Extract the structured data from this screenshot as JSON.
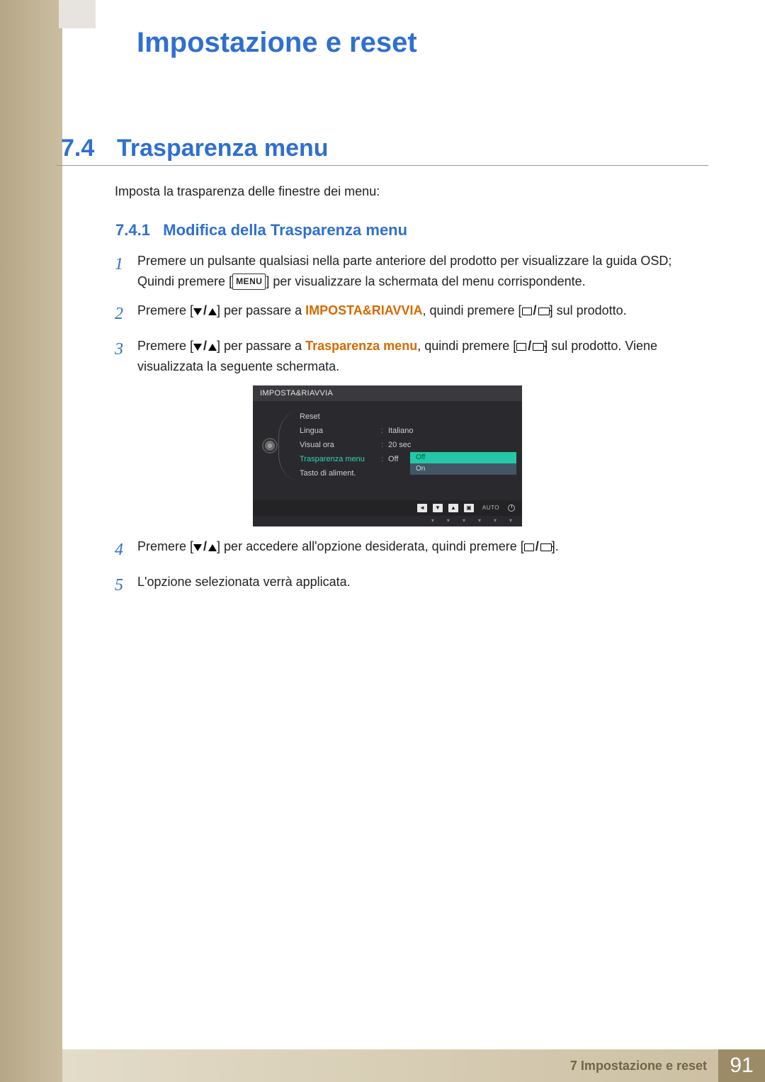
{
  "chapter": {
    "title": "Impostazione e reset"
  },
  "section": {
    "number": "7.4",
    "title": "Trasparenza menu"
  },
  "intro": "Imposta la trasparenza delle finestre dei menu:",
  "subsection": {
    "number": "7.4.1",
    "title": "Modifica della Trasparenza menu"
  },
  "steps": {
    "s1a": "Premere un pulsante qualsiasi nella parte anteriore del prodotto per visualizzare la guida OSD;",
    "s1b_pre": "Quindi premere [",
    "s1b_key": "MENU",
    "s1b_post": "] per visualizzare la schermata del menu corrispondente.",
    "s2_pre": "Premere [",
    "s2_mid1": "] per passare a ",
    "s2_target": "IMPOSTA&RIAVVIA",
    "s2_mid2": ", quindi premere [",
    "s2_post": "] sul prodotto.",
    "s3_pre": "Premere [",
    "s3_mid1": "] per passare a ",
    "s3_target": "Trasparenza menu",
    "s3_mid2": ", quindi premere [",
    "s3_post": "] sul prodotto. Viene visualizzata la seguente schermata.",
    "s4_pre": "Premere [",
    "s4_mid": "] per accedere all'opzione desiderata, quindi premere [",
    "s4_post": "].",
    "s5": "L'opzione selezionata verrà applicata."
  },
  "osd": {
    "title": "IMPOSTA&RIAVVIA",
    "rows": [
      {
        "label": "Reset",
        "value": ""
      },
      {
        "label": "Lingua",
        "value": "Italiano"
      },
      {
        "label": "Visual ora",
        "value": "20 sec"
      },
      {
        "label": "Trasparenza menu",
        "value": "Off",
        "selected": true
      },
      {
        "label": "Tasto di aliment.",
        "value": ""
      }
    ],
    "options": [
      "Off",
      "On"
    ],
    "footer_auto": "AUTO"
  },
  "footer": {
    "chapter": "7 Impostazione e reset",
    "page": "91"
  }
}
